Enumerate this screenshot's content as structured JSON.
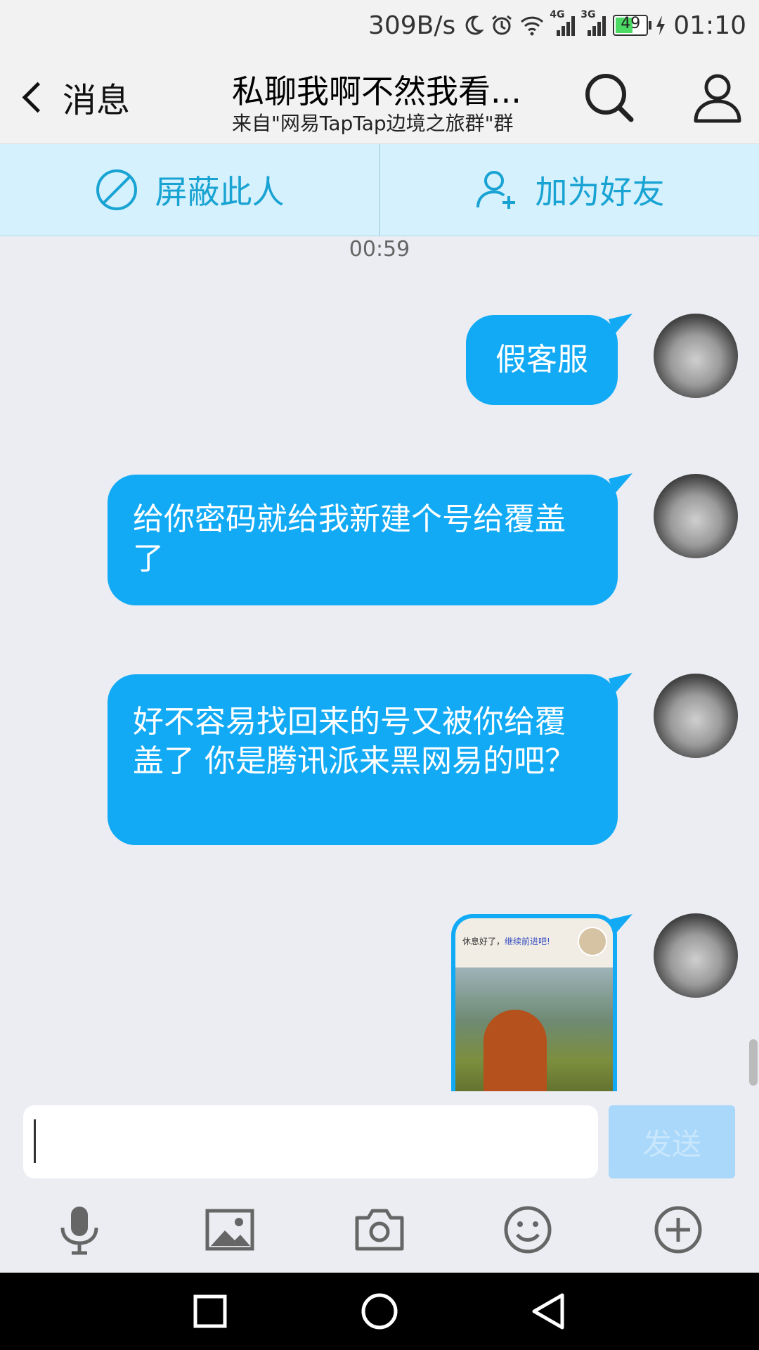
{
  "status_bar": {
    "net_speed": "309B/s",
    "net1": "4G",
    "net2": "3G",
    "battery": "49",
    "time": "01:10"
  },
  "header": {
    "back_label": "消息",
    "title": "私聊我啊不然我看...",
    "subtitle": "来自\"网易TapTap边境之旅群\"群"
  },
  "actions": {
    "block_label": "屏蔽此人",
    "add_friend_label": "加为好友"
  },
  "chat": {
    "timestamp": "00:59",
    "messages": [
      {
        "text": "假客服"
      },
      {
        "text": "给你密码就给我新建个号给覆盖了"
      },
      {
        "text": "好不容易找回来的号又被你给覆盖了 你是腾讯派来黑网易的吧？"
      }
    ],
    "image_message": {
      "caption_plain": "休息好了，",
      "caption_link": "继续前进吧!"
    }
  },
  "input": {
    "value": "",
    "send_label": "发送"
  },
  "colors": {
    "bubble": "#12aaf5",
    "action_text": "#19a3d3",
    "action_bg": "#d4f1fd",
    "send_disabled": "#a9d8fb"
  },
  "icons": {
    "toolbar": [
      "microphone-icon",
      "image-icon",
      "camera-icon",
      "emoji-icon",
      "plus-icon"
    ],
    "nav": [
      "recents-icon",
      "home-icon",
      "back-icon"
    ]
  }
}
